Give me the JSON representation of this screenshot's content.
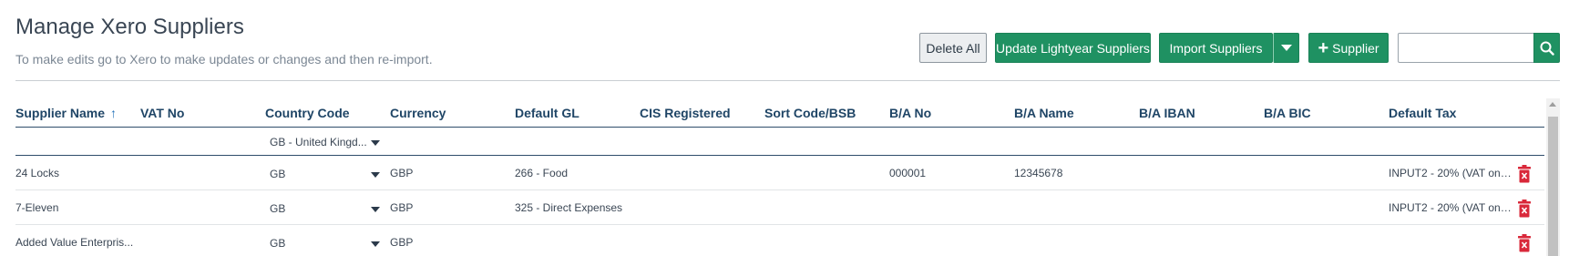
{
  "page": {
    "title": "Manage Xero Suppliers",
    "subtitle": "To make edits go to Xero to make updates or changes and then re-import."
  },
  "toolbar": {
    "delete_all": "Delete All",
    "update_lightyear": "Update Lightyear Suppliers",
    "import_suppliers": "Import Suppliers",
    "add_supplier": "Supplier",
    "search_value": "",
    "search_placeholder": ""
  },
  "table": {
    "headers": {
      "supplier_name": "Supplier Name",
      "vat_no": "VAT No",
      "country_code": "Country Code",
      "currency": "Currency",
      "default_gl": "Default GL",
      "cis_registered": "CIS Registered",
      "sort_code": "Sort Code/BSB",
      "ba_no": "B/A No",
      "ba_name": "B/A Name",
      "ba_iban": "B/A IBAN",
      "ba_bic": "B/A BIC",
      "default_tax": "Default Tax"
    },
    "sort_column": "supplier_name",
    "sort_direction": "ascending",
    "filter": {
      "country_code": "GB - United Kingd..."
    },
    "rows": [
      {
        "supplier_name": "24 Locks",
        "vat_no": "",
        "country_code": "GB",
        "currency": "GBP",
        "default_gl": "266 - Food",
        "cis_registered": "",
        "sort_code": "",
        "ba_no": "000001",
        "ba_name": "12345678",
        "ba_iban": "",
        "ba_bic": "",
        "default_tax": "INPUT2 - 20% (VAT on ..."
      },
      {
        "supplier_name": "7-Eleven",
        "vat_no": "",
        "country_code": "GB",
        "currency": "GBP",
        "default_gl": "325 - Direct Expenses",
        "cis_registered": "",
        "sort_code": "",
        "ba_no": "",
        "ba_name": "",
        "ba_iban": "",
        "ba_bic": "",
        "default_tax": "INPUT2 - 20% (VAT on ..."
      },
      {
        "supplier_name": "Added Value Enterpris...",
        "vat_no": "",
        "country_code": "GB",
        "currency": "GBP",
        "default_gl": "",
        "cis_registered": "",
        "sort_code": "",
        "ba_no": "",
        "ba_name": "",
        "ba_iban": "",
        "ba_bic": "",
        "default_tax": ""
      }
    ]
  },
  "icons": {
    "sort": "arrow-up-icon",
    "search": "search-icon",
    "delete": "trash-icon",
    "dropdown": "caret-down-icon"
  },
  "colors": {
    "primary_green": "#1f9162",
    "header_text": "#1f4566",
    "delete_red": "#d9283a",
    "sort_arrow": "#1f6fb8"
  }
}
